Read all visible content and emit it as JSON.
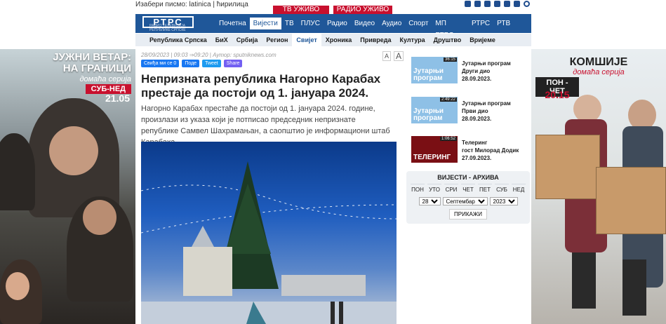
{
  "topbar": {
    "script_label": "Изабери писмо:",
    "latin": "latinica",
    "sep": "|",
    "cyrillic": "ћирилица",
    "tv_live": "ТВ УЖИВО",
    "radio_live": "РАДИО УЖИВО",
    "social_icons": [
      "facebook-icon",
      "instagram-icon",
      "twitter-icon",
      "youtube-icon",
      "tiktok-icon",
      "mail-icon",
      "search-icon"
    ]
  },
  "logo": {
    "text": "РТРС",
    "tagline": "РАДИО ТЕЛЕВИЗИЈА РЕПУБЛИКЕ СРПСКЕ"
  },
  "nav": {
    "items": [
      "Почетна",
      "Вијести",
      "ТВ",
      "ПЛУС",
      "Радио",
      "Видео",
      "Аудио",
      "Спорт",
      "МП РТРС",
      "РТРС",
      "РТВ такса"
    ],
    "active_index": 1
  },
  "subnav": {
    "items": [
      "Република Српска",
      "БиХ",
      "Србија",
      "Регион",
      "Свијет",
      "Хроника",
      "Привреда",
      "Култура",
      "Друштво",
      "Вријеме"
    ],
    "active_index": 4
  },
  "article": {
    "date": "28/09/2023",
    "time": "09:03",
    "updated": "⇒09:20",
    "author": "Аутор: sputniknews.com",
    "font_small": "A",
    "font_big": "A",
    "share": {
      "fb": "Свиђа ми се 0",
      "fb_share": "Поде",
      "tweet": "Tweet",
      "viber": "Share"
    },
    "title": "Непризната република Нагорно Карабах престаје да постоји од 1. јануара 2024.",
    "lead": "Нагорно Карабах престаће да постоји од 1. јануара 2024. године, произлази из указа који је потписао председник непризнате републике Самвел Шахрамањан, а саопштио је информациони штаб Карабаха."
  },
  "schedule": [
    {
      "thumb": "Јутарњи програм",
      "duration": "36:15",
      "line1": "Јутарњи програм",
      "line2": "Други дио",
      "date": "28.09.2023."
    },
    {
      "thumb": "Јутарњи програм",
      "duration": "2:49:22",
      "line1": "Јутарњи програм",
      "line2": "Први дио",
      "date": "28.09.2023."
    },
    {
      "thumb": "ТЕЛЕРИНГ",
      "duration": "1:06:52",
      "line1": "Телеринг",
      "line2": "гост Милорад Додик",
      "date": "27.09.2023."
    }
  ],
  "archive": {
    "title": "ВИЈЕСТИ - АРХИВА",
    "days": [
      "ПОН",
      "УТО",
      "СРИ",
      "ЧЕТ",
      "ПЕТ",
      "СУБ",
      "НЕД"
    ],
    "day_value": "28",
    "month_value": "Септембар",
    "year_value": "2023",
    "button": "ПРИКАЖИ"
  },
  "ads": {
    "left": {
      "title_line1": "ЈУЖНИ ВЕТАР:",
      "title_line2": "НА ГРАНИЦИ",
      "sub": "домаћа серија",
      "days": "СУБ-НЕД",
      "time": "21.05"
    },
    "right": {
      "title": "КОМШИЈЕ",
      "sub": "домаћа серија",
      "days": "ПОН - ЧЕТ",
      "time": "20.15"
    }
  },
  "colors": {
    "brand_blue": "#1f5799",
    "live_red": "#c8102e",
    "subnav_bg": "#e8edf3"
  }
}
